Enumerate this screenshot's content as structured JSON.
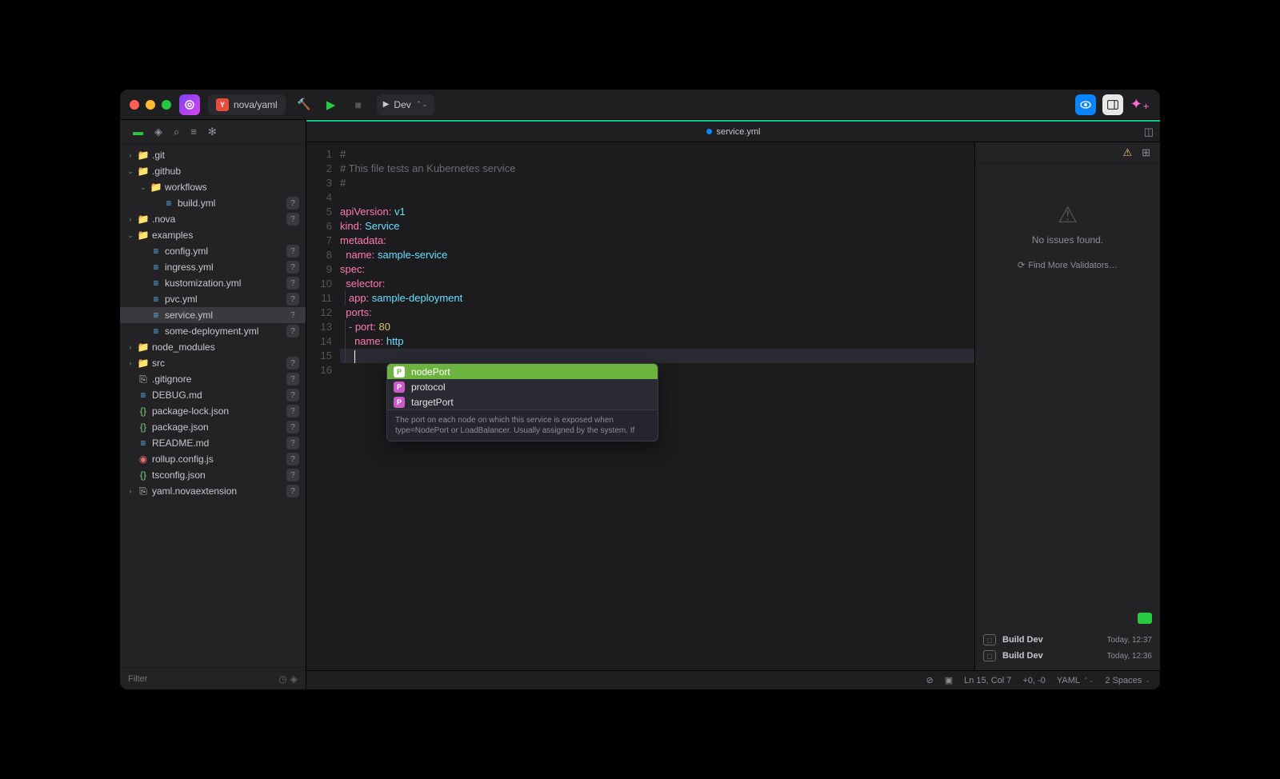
{
  "titlebar": {
    "project_path": "nova/yaml",
    "task_dropdown": "Dev"
  },
  "tree": [
    {
      "depth": 0,
      "arrow": "›",
      "icon": "📁",
      "iconClass": "folder-blue",
      "name": ".git",
      "badge": null
    },
    {
      "depth": 0,
      "arrow": "⌄",
      "icon": "📁",
      "iconClass": "folder-blue",
      "name": ".github",
      "badge": null
    },
    {
      "depth": 1,
      "arrow": "⌄",
      "icon": "📁",
      "iconClass": "folder-blue",
      "name": "workflows",
      "badge": null
    },
    {
      "depth": 2,
      "arrow": "",
      "icon": "≡",
      "iconClass": "file-blue",
      "name": "build.yml",
      "badge": "?"
    },
    {
      "depth": 0,
      "arrow": "›",
      "icon": "📁",
      "iconClass": "folder-blue",
      "name": ".nova",
      "badge": "?"
    },
    {
      "depth": 0,
      "arrow": "⌄",
      "icon": "📁",
      "iconClass": "folder-blue",
      "name": "examples",
      "badge": null
    },
    {
      "depth": 1,
      "arrow": "",
      "icon": "≡",
      "iconClass": "file-blue",
      "name": "config.yml",
      "badge": "?"
    },
    {
      "depth": 1,
      "arrow": "",
      "icon": "≡",
      "iconClass": "file-blue",
      "name": "ingress.yml",
      "badge": "?"
    },
    {
      "depth": 1,
      "arrow": "",
      "icon": "≡",
      "iconClass": "file-blue",
      "name": "kustomization.yml",
      "badge": "?"
    },
    {
      "depth": 1,
      "arrow": "",
      "icon": "≡",
      "iconClass": "file-blue",
      "name": "pvc.yml",
      "badge": "?"
    },
    {
      "depth": 1,
      "arrow": "",
      "icon": "≡",
      "iconClass": "file-blue",
      "name": "service.yml",
      "badge": "?",
      "selected": true
    },
    {
      "depth": 1,
      "arrow": "",
      "icon": "≡",
      "iconClass": "file-blue",
      "name": "some-deployment.yml",
      "badge": "?"
    },
    {
      "depth": 0,
      "arrow": "›",
      "icon": "📁",
      "iconClass": "folder-blue",
      "name": "node_modules",
      "badge": null
    },
    {
      "depth": 0,
      "arrow": "›",
      "icon": "📁",
      "iconClass": "folder-blue",
      "name": "src",
      "badge": "?"
    },
    {
      "depth": 0,
      "arrow": "",
      "icon": "⎘",
      "iconClass": "file-white",
      "name": ".gitignore",
      "badge": "?"
    },
    {
      "depth": 0,
      "arrow": "",
      "icon": "≡",
      "iconClass": "file-blue",
      "name": "DEBUG.md",
      "badge": "?"
    },
    {
      "depth": 0,
      "arrow": "",
      "icon": "{}",
      "iconClass": "file-green",
      "name": "package-lock.json",
      "badge": "?"
    },
    {
      "depth": 0,
      "arrow": "",
      "icon": "{}",
      "iconClass": "file-green",
      "name": "package.json",
      "badge": "?"
    },
    {
      "depth": 0,
      "arrow": "",
      "icon": "≡",
      "iconClass": "file-blue",
      "name": "README.md",
      "badge": "?"
    },
    {
      "depth": 0,
      "arrow": "",
      "icon": "◉",
      "iconClass": "file-red",
      "name": "rollup.config.js",
      "badge": "?"
    },
    {
      "depth": 0,
      "arrow": "",
      "icon": "{}",
      "iconClass": "file-green",
      "name": "tsconfig.json",
      "badge": "?"
    },
    {
      "depth": 0,
      "arrow": "›",
      "icon": "⎘",
      "iconClass": "file-white",
      "name": "yaml.novaextension",
      "badge": "?"
    }
  ],
  "filter_placeholder": "Filter",
  "tab": {
    "filename": "service.yml"
  },
  "code_lines": [
    {
      "n": 1,
      "html": "<span class='c-comment'>#</span>"
    },
    {
      "n": 2,
      "html": "<span class='c-comment'># This file tests an Kubernetes service</span>"
    },
    {
      "n": 3,
      "html": "<span class='c-comment'>#</span>"
    },
    {
      "n": 4,
      "html": ""
    },
    {
      "n": 5,
      "html": "<span class='c-key'>apiVersion:</span> <span class='c-val'>v1</span>"
    },
    {
      "n": 6,
      "html": "<span class='c-key'>kind:</span> <span class='c-val'>Service</span>"
    },
    {
      "n": 7,
      "html": "<span class='c-key'>metadata:</span>"
    },
    {
      "n": 8,
      "html": "  <span class='c-key'>name:</span> <span class='c-val'>sample-service</span>"
    },
    {
      "n": 9,
      "html": "<span class='c-key'>spec:</span>"
    },
    {
      "n": 10,
      "html": "  <span class='c-key'>selector:</span>"
    },
    {
      "n": 11,
      "html": "  <span class='guide'></span> <span class='c-key'>app:</span> <span class='c-val'>sample-deployment</span>"
    },
    {
      "n": 12,
      "html": "  <span class='c-key'>ports:</span>"
    },
    {
      "n": 13,
      "html": "  <span class='guide'></span> <span class='c-purple'>-</span> <span class='c-key'>port:</span> <span class='c-num'>80</span>"
    },
    {
      "n": 14,
      "html": "  <span class='guide'></span>   <span class='c-key'>name:</span> <span class='c-val'>http</span>"
    },
    {
      "n": 15,
      "html": "  <span class='guide'></span>   <span class='cursor'></span>",
      "current": true
    },
    {
      "n": 16,
      "html": ""
    }
  ],
  "completion": {
    "items": [
      {
        "label": "nodePort",
        "selected": true
      },
      {
        "label": "protocol",
        "selected": false
      },
      {
        "label": "targetPort",
        "selected": false
      }
    ],
    "description": "The port on each node on which this service is exposed when type=NodePort or LoadBalancer. Usually assigned by the system. If"
  },
  "issues": {
    "message": "No issues found.",
    "link": "Find More Validators…"
  },
  "tasks": [
    {
      "name": "Build Dev",
      "time": "Today, 12:37"
    },
    {
      "name": "Build Dev",
      "time": "Today, 12:36"
    }
  ],
  "status": {
    "position": "Ln 15, Col 7",
    "diff": "+0, -0",
    "language": "YAML",
    "indent": "2 Spaces"
  }
}
